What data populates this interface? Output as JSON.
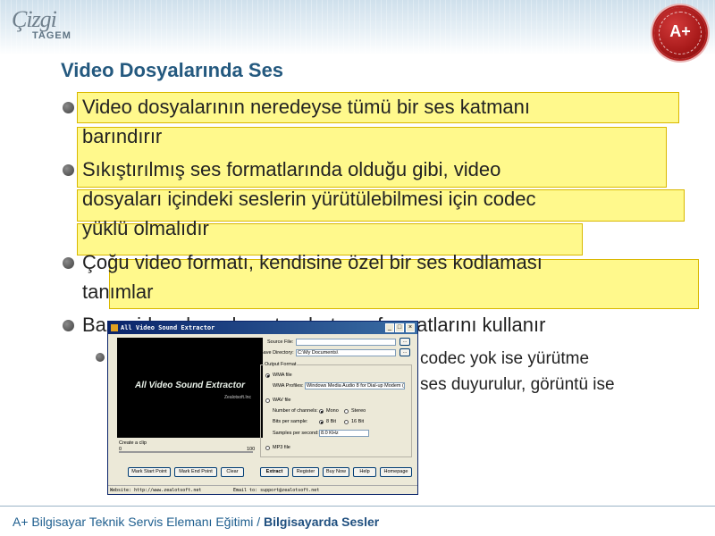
{
  "logo": {
    "text": "Çizgi",
    "sub": "TAGEM"
  },
  "seal": {
    "text": "A+"
  },
  "slide": {
    "title": "Video Dosyalarında Ses",
    "bullets": [
      "Video dosyalarının neredeyse tümü bir ses katmanı",
      "barındırır",
      "Sıkıştırılmış ses formatlarında olduğu gibi, video",
      "dosyaları içindeki seslerin yürütülebilmesi için codec",
      "yüklü olmalıdır",
      "Çoğu video formatı, kendisine özel bir ses kodlaması",
      "tanımlar",
      "Bazı video dosyaları standart ses formatlarını kullanır"
    ],
    "sub_bullets": [
      "codec yok ise yürütme",
      "ses duyurulur, görüntü ise"
    ]
  },
  "app": {
    "title": "All Video Sound Extractor",
    "brand_title": "All Video Sound Extractor",
    "brand_sub": "Zealotsoft.Inc",
    "source_file_label": "Source File:",
    "source_file_value": "",
    "save_dir_label": "Save Directory:",
    "save_dir_value": "C:\\My Documents\\",
    "browse": "...",
    "output_format_label": "Output Format",
    "wma_file": "WMA file",
    "wma_profiles_label": "WMA Profiles:",
    "wma_profile_value": "Windows Media Audio 8 for Dial-up Modem (Mono)",
    "wav_file": "WAV file",
    "channels_label": "Number of channels:",
    "mono": "Mono",
    "stereo": "Stereo",
    "bits_label": "Bits per sample:",
    "bit8": "8 Bit",
    "bit16": "16 Bit",
    "samples_label": "Samples per second:",
    "samples_value": "8.0 KHz",
    "mp3_file": "MP3 file",
    "clip_label": "Create a clip",
    "clip_min": "0",
    "clip_max": "100",
    "mark_start": "Mark Start Point",
    "mark_end": "Mark End Point",
    "clear": "Clear",
    "extract": "Extract",
    "register": "Register",
    "buy_now": "Buy Now",
    "help": "Help",
    "homepage": "Homepage",
    "status_website": "Website: http://www.zealotsoft.net",
    "status_email": "Email to: support@zealotsoft.net"
  },
  "footer": {
    "course": "A+ Bilgisayar Teknik Servis Elemanı Eğitimi /",
    "chapter": "Bilgisayarda Sesler"
  },
  "colors": {
    "title": "#24597f",
    "highlight": "#fff200",
    "footer": "#1f5f8f"
  }
}
